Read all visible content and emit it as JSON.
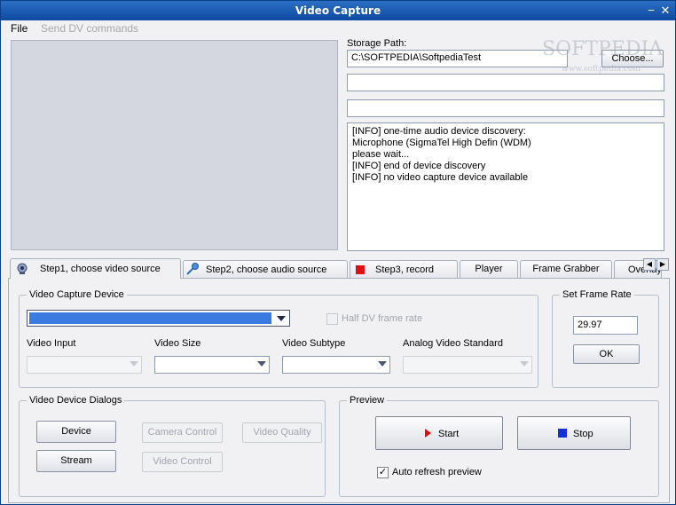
{
  "window": {
    "title": "Video Capture",
    "minimize_glyph": "−",
    "close_glyph": "✕"
  },
  "menu": {
    "file": "File",
    "send_dv": "Send DV commands"
  },
  "storage": {
    "label": "Storage Path:",
    "path": "C:\\SOFTPEDIA\\SoftpediaTest",
    "choose": "Choose..."
  },
  "log": {
    "lines": [
      "[INFO] one-time audio device discovery:",
      "Microphone (SigmaTel High Defin (WDM)",
      "please wait...",
      "[INFO] end of device discovery",
      "[INFO] no video capture device available"
    ]
  },
  "tabs": [
    {
      "label": "Step1, choose video source",
      "icon": "webcam-icon"
    },
    {
      "label": "Step2, choose audio source",
      "icon": "microphone-icon"
    },
    {
      "label": "Step3, record",
      "icon": "record-icon"
    },
    {
      "label": "Player"
    },
    {
      "label": "Frame Grabber"
    },
    {
      "label": "Overlays"
    }
  ],
  "video_capture": {
    "group_title": "Video Capture Device",
    "half_dv": "Half DV frame rate",
    "video_input": "Video Input",
    "video_size": "Video Size",
    "video_subtype": "Video Subtype",
    "analog_standard": "Analog Video Standard"
  },
  "frame_rate": {
    "group_title": "Set Frame Rate",
    "value": "29.97",
    "ok": "OK"
  },
  "dialogs": {
    "group_title": "Video Device Dialogs",
    "device": "Device",
    "stream": "Stream",
    "camera_control": "Camera Control",
    "video_control": "Video Control",
    "video_quality": "Video Quality"
  },
  "preview": {
    "group_title": "Preview",
    "start": "Start",
    "stop": "Stop",
    "auto_refresh": "Auto refresh preview",
    "auto_refresh_checked": true
  },
  "watermark": {
    "main": "SOFTPEDIA",
    "sub": "www.softpedia.com"
  },
  "colors": {
    "selection": "#3a7be0",
    "start_arrow": "#e01010",
    "stop_square": "#1030e0",
    "record_square": "#e01010"
  }
}
